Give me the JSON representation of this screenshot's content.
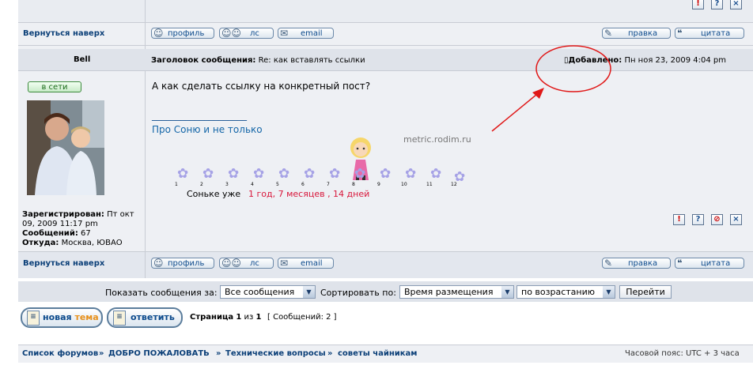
{
  "post_prev": {
    "back_to_top": "Вернуться наверх",
    "buttons": {
      "profile": "профиль",
      "pm": "лс",
      "email": "email",
      "edit": "правка",
      "quote": "цитата"
    }
  },
  "post": {
    "author": "Bell",
    "subject_label": "Заголовок сообщения:",
    "subject_value": "Re: как вставлять ссылки",
    "posted_label": "Добавлено:",
    "posted_value": "Пн ноя 23, 2009 4:04 pm",
    "online_badge": "в сети",
    "body": "А как сделать ссылку на конкретный пост?",
    "signature_rule": "____________________",
    "signature_link": "Про Соню и не только",
    "watermark": "metric.rodim.ru",
    "ticker_prefix": "Соньке уже",
    "ticker_value": "1 год, 7 месяцев , 14 дней",
    "ticker_numbers": [
      "1",
      "2",
      "3",
      "4",
      "5",
      "6",
      "7",
      "8",
      "9",
      "10",
      "11",
      "12"
    ],
    "profile": {
      "registered_label": "Зарегистрирован:",
      "registered_value": "Пт окт 09, 2009 11:17 pm",
      "posts_label": "Сообщений:",
      "posts_value": "67",
      "from_label": "Откуда:",
      "from_value": "Москва, ЮВАО"
    },
    "back_to_top": "Вернуться наверх",
    "buttons": {
      "profile": "профиль",
      "pm": "лс",
      "email": "email",
      "edit": "правка",
      "quote": "цитата"
    }
  },
  "sort_bar": {
    "show_label": "Показать сообщения за:",
    "show_value": "Все сообщения",
    "sort_label": "Сортировать по:",
    "sort_value": "Время размещения",
    "order_value": "по возрастанию",
    "go_button": "Перейти"
  },
  "actions": {
    "new_topic_a": "новая",
    "new_topic_b": "тема",
    "reply": "ответить",
    "page_prefix": "Страница",
    "page_current": "1",
    "page_of": "из",
    "page_total": "1",
    "messages_count": "[ Сообщений: 2 ]"
  },
  "breadcrumb": {
    "items": [
      "Список форумов",
      "ДОБРО ПОЖАЛОВАТЬ",
      "Технические вопросы",
      "советы чайникам"
    ],
    "separator": "»",
    "timezone": "Часовой пояс: UTC + 3 часа"
  },
  "colors": {
    "accent": "#0c4a8c",
    "annotation": "#e01818",
    "ticker_red": "#d8163a"
  }
}
